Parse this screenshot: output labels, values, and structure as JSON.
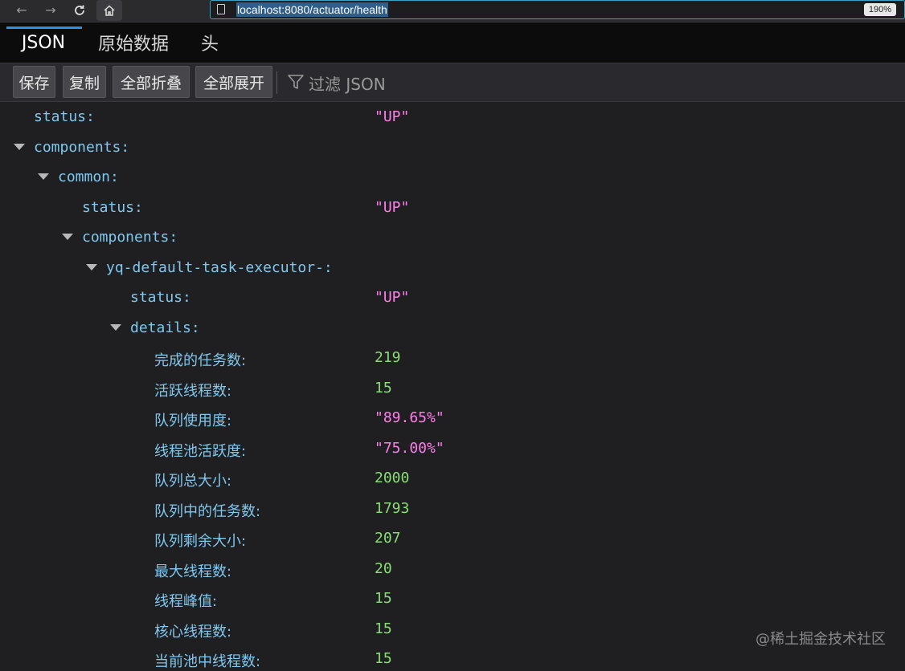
{
  "browser": {
    "url": "localhost:8080/actuator/health",
    "zoom": "190%"
  },
  "tabs": [
    "JSON",
    "原始数据",
    "头"
  ],
  "toolbar": {
    "save": "保存",
    "copy": "复制",
    "collapse_all": "全部折叠",
    "expand_all": "全部展开",
    "filter_placeholder": "过滤 JSON"
  },
  "tree": [
    {
      "key": "status:",
      "value": "\"UP\"",
      "type": "string",
      "depth": 0,
      "toggle": false
    },
    {
      "key": "components:",
      "value": "",
      "type": "object",
      "depth": 0,
      "toggle": true
    },
    {
      "key": "common:",
      "value": "",
      "type": "object",
      "depth": 1,
      "toggle": true
    },
    {
      "key": "status:",
      "value": "\"UP\"",
      "type": "string",
      "depth": 2,
      "toggle": false
    },
    {
      "key": "components:",
      "value": "",
      "type": "object",
      "depth": 2,
      "toggle": true
    },
    {
      "key": "yq-default-task-executor-:",
      "value": "",
      "type": "object",
      "depth": 3,
      "toggle": true
    },
    {
      "key": "status:",
      "value": "\"UP\"",
      "type": "string",
      "depth": 4,
      "toggle": false
    },
    {
      "key": "details:",
      "value": "",
      "type": "object",
      "depth": 4,
      "toggle": true
    },
    {
      "key": "完成的任务数:",
      "value": "219",
      "type": "number",
      "depth": 5,
      "toggle": false
    },
    {
      "key": "活跃线程数:",
      "value": "15",
      "type": "number",
      "depth": 5,
      "toggle": false
    },
    {
      "key": "队列使用度:",
      "value": "\"89.65%\"",
      "type": "string",
      "depth": 5,
      "toggle": false
    },
    {
      "key": "线程池活跃度:",
      "value": "\"75.00%\"",
      "type": "string",
      "depth": 5,
      "toggle": false
    },
    {
      "key": "队列总大小:",
      "value": "2000",
      "type": "number",
      "depth": 5,
      "toggle": false
    },
    {
      "key": "队列中的任务数:",
      "value": "1793",
      "type": "number",
      "depth": 5,
      "toggle": false
    },
    {
      "key": "队列剩余大小:",
      "value": "207",
      "type": "number",
      "depth": 5,
      "toggle": false
    },
    {
      "key": "最大线程数:",
      "value": "20",
      "type": "number",
      "depth": 5,
      "toggle": false
    },
    {
      "key": "线程峰值:",
      "value": "15",
      "type": "number",
      "depth": 5,
      "toggle": false
    },
    {
      "key": "核心线程数:",
      "value": "15",
      "type": "number",
      "depth": 5,
      "toggle": false
    },
    {
      "key": "当前池中线程数:",
      "value": "15",
      "type": "number",
      "depth": 5,
      "toggle": false
    }
  ],
  "watermark": "@稀土掘金技术社区",
  "colors": {
    "key": "#7fc8ef",
    "string": "#ff7de9",
    "number": "#86de74",
    "active_tab": "#2f8fe0"
  }
}
